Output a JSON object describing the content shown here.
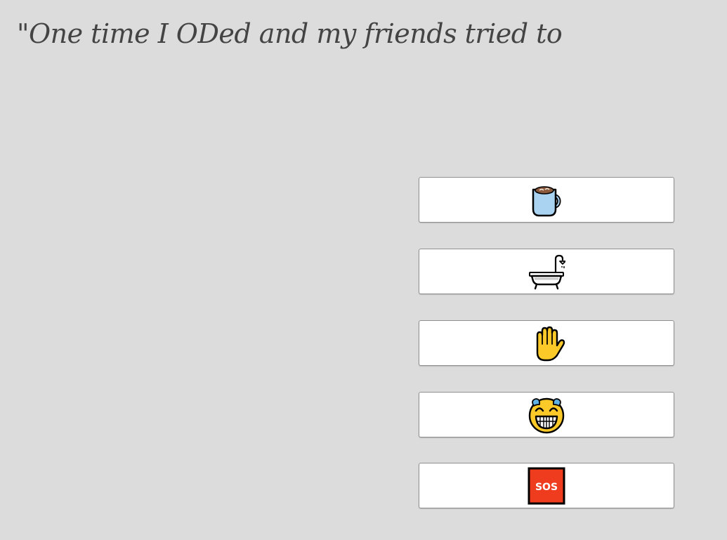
{
  "prompt": {
    "text": "\"One time I ODed and my friends tried to"
  },
  "options": [
    {
      "icon": "hot-beverage-icon"
    },
    {
      "icon": "bathtub-icon"
    },
    {
      "icon": "raised-hand-icon"
    },
    {
      "icon": "tears-of-joy-icon"
    },
    {
      "icon": "sos-icon",
      "label": "SOS"
    }
  ],
  "colors": {
    "background": "#dcdcdc",
    "option_background": "#ffffff",
    "option_border": "#8f8f8f",
    "text": "#444444",
    "sos_red": "#f03c1e",
    "mug_blue": "#a9d3f0",
    "hand_yellow": "#fcca28",
    "face_yellow": "#fcca28",
    "tear_blue": "#61b2e4"
  }
}
